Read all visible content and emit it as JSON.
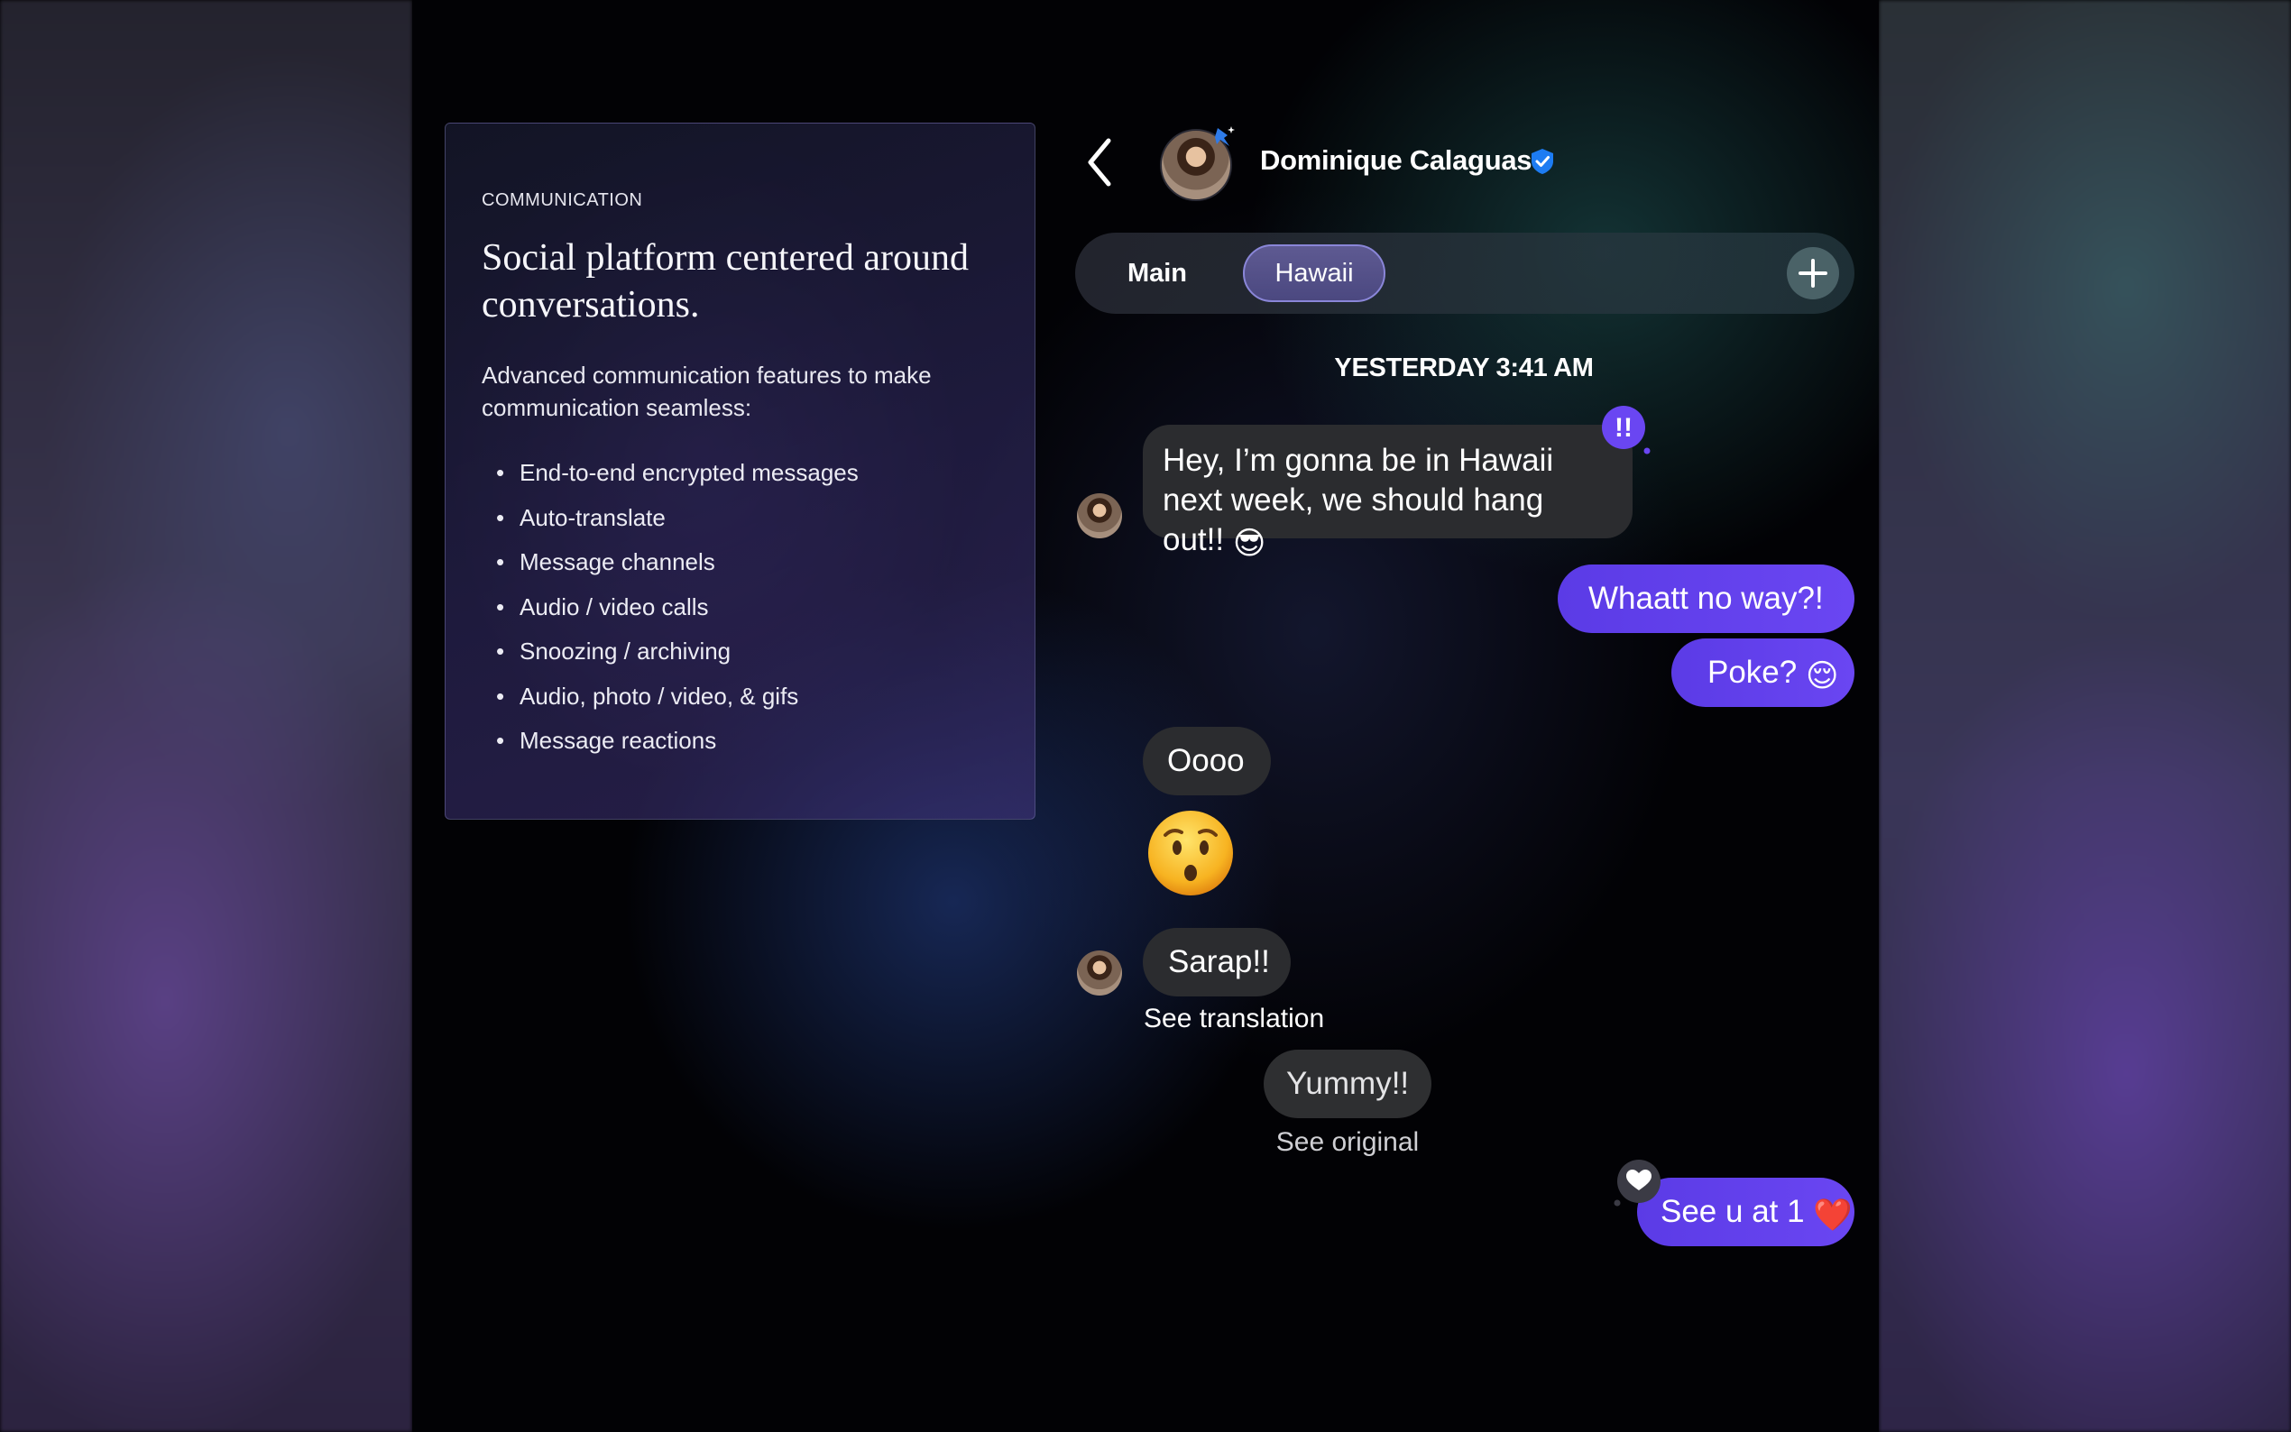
{
  "info_card": {
    "eyebrow": "COMMUNICATION",
    "title": "Social platform centered around conversations.",
    "description": "Advanced communication features to make communication seamless:",
    "features": [
      "End-to-end encrypted messages",
      "Auto-translate",
      "Message channels",
      "Audio / video calls",
      "Snoozing / archiving",
      "Audio, photo / video, & gifs",
      "Message reactions"
    ]
  },
  "header": {
    "contact_name": "Dominique Calaguas",
    "verified": true,
    "icons": [
      "chevron-left-icon",
      "verified-badge-icon",
      "headset-icon",
      "more-icon"
    ]
  },
  "tabs": [
    {
      "label": "Main",
      "active": false
    },
    {
      "label": "Hawaii",
      "active": true
    }
  ],
  "timestamp": "YESTERDAY 3:41 AM",
  "messages": [
    {
      "from": "contact",
      "text": "Hey, I’m gonna be in Hawaii next week, we should hang out!!",
      "emoji": "😎",
      "reaction": "!!"
    },
    {
      "from": "me",
      "text": "Whaatt no way?!"
    },
    {
      "from": "me",
      "text": "Poke?",
      "emoji": "😌"
    },
    {
      "from": "contact",
      "text": "Oooo"
    },
    {
      "from": "contact",
      "emoji_only": "😯"
    },
    {
      "from": "contact",
      "text": "Sarap!!",
      "action": "See translation"
    },
    {
      "from": "translation",
      "text": "Yummy!!",
      "action": "See original"
    },
    {
      "from": "me",
      "text": "See u at 1",
      "emoji": "❤️",
      "reaction": "heart"
    }
  ],
  "colors": {
    "outgoing_bubble": "#6240ec",
    "incoming_bubble": "#2b2c2f",
    "verified_blue": "#1d7cf2",
    "active_tab": "#56538a"
  }
}
